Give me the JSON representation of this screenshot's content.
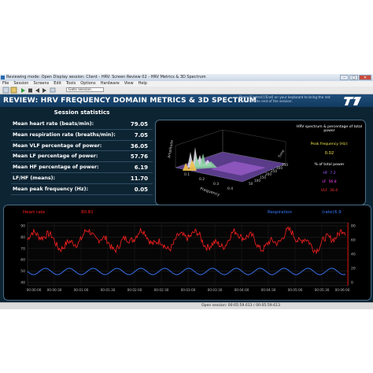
{
  "window": {
    "title": "Reviewing mode: Open Display session: Client - HRV: Screen Review 02 - HRV Metrics & 3D Spectrum",
    "buttons": [
      "–",
      "□",
      "✕"
    ]
  },
  "menu": [
    "File",
    "Session",
    "Screens",
    "Edit",
    "Tools",
    "Options",
    "Hardware",
    "View",
    "Help"
  ],
  "toolbar": {
    "select_value": "Goto session",
    "icons": [
      "play-icon",
      "stop-icon",
      "back-icon",
      "forward-icon"
    ]
  },
  "header": {
    "title": "REVIEW: HRV FREQUENCY DOMAIN METRICS & 3D SPECTRUM",
    "hint": "Press [Control] [End] on your keyboard to bring the red cursor to the end of the session."
  },
  "stats": {
    "heading": "Session statistics",
    "rows": [
      {
        "label": "Mean heart rate (beats/min):",
        "value": "79.05"
      },
      {
        "label": "Mean respiration rate (breaths/min):",
        "value": "7.05"
      },
      {
        "label": "Mean VLF percentage of power:",
        "value": "36.05"
      },
      {
        "label": "Mean LF percentage of power:",
        "value": "57.76"
      },
      {
        "label": "Mean HF percentage of power:",
        "value": "6.19"
      },
      {
        "label": "LF/HF (means):",
        "value": "11.70"
      },
      {
        "label": "Mean peak frequency (Hz):",
        "value": "0.05"
      }
    ]
  },
  "spectrum": {
    "legend_title": "HRV spectrum & percentage of total power",
    "peak_label": "Peak frequency (Hz):",
    "peak_value": "0.02",
    "pct_label": "% of total power",
    "bands": [
      {
        "name": "HF",
        "value": "7.2",
        "color": "#a05cff"
      },
      {
        "name": "LF",
        "value": "56.8",
        "color": "#ff40ff"
      },
      {
        "name": "VLF",
        "value": "36.0",
        "color": "#ff3030"
      }
    ],
    "axis_freq_label": "Frequency",
    "axis_amp_label": "Amplitude",
    "axis_time_label": "Time",
    "freq_ticks": [
      "0.1",
      "0.2",
      "0.3",
      "0.4"
    ],
    "time_ticks": [
      "50",
      "100",
      "150",
      "200",
      "250",
      "300",
      "350"
    ]
  },
  "trends": {
    "hr_label": "Heart rate",
    "hr_value": "80.81",
    "resp_label": "Respiration",
    "resp_rate_label": "(rate)",
    "resp_value": "6.9",
    "hr_color": "#ff2020",
    "resp_color": "#3a7bff",
    "left_ticks": [
      "90",
      "80",
      "70",
      "60",
      "50",
      "40"
    ],
    "right_ticks": [
      "80",
      "60",
      "40",
      "20",
      "0"
    ],
    "x_ticks": [
      "00:00:00",
      "00:00:30",
      "00:01:00",
      "00:01:30",
      "00:02:00",
      "00:02:30",
      "00:03:00",
      "00:03:30",
      "00:04:00",
      "00:04:30",
      "00:05:00",
      "00:05:30",
      "00:06:00"
    ]
  },
  "status": {
    "text": "Open session: 00:05:59.613 / 00:05:59.613"
  }
}
